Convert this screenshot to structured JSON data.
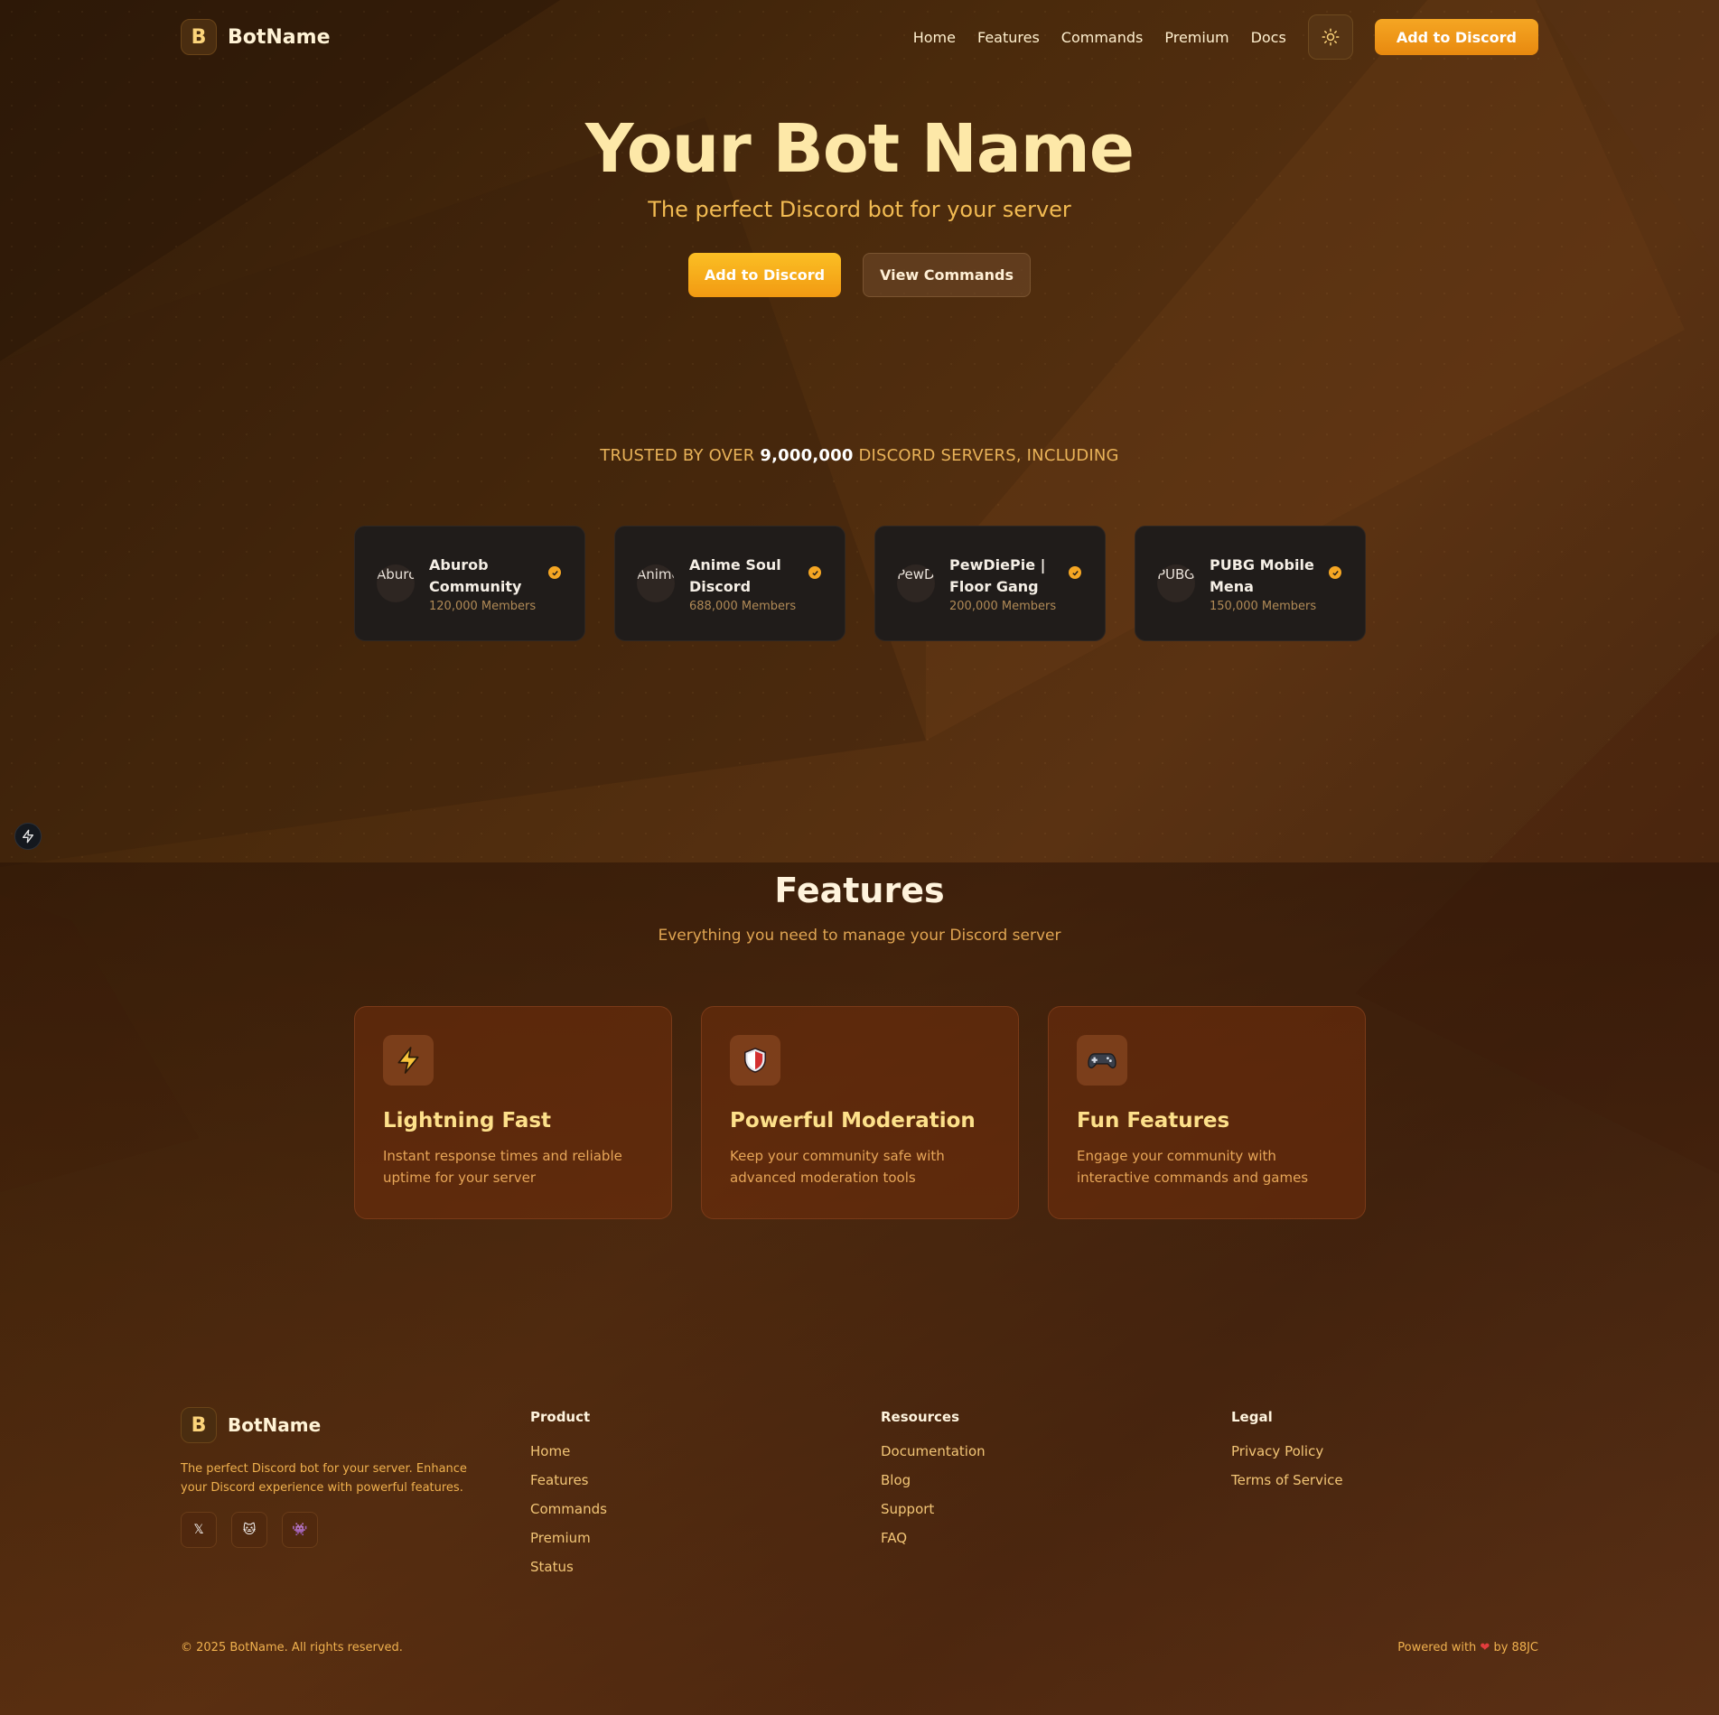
{
  "nav": {
    "logo_letter": "B",
    "brand": "BotName",
    "links": [
      "Home",
      "Features",
      "Commands",
      "Premium",
      "Docs"
    ],
    "theme_icon": "sun-icon",
    "cta": "Add to Discord"
  },
  "hero": {
    "title": "Your Bot Name",
    "subtitle": "The perfect Discord bot for your server",
    "primary_button": "Add to Discord",
    "secondary_button": "View Commands"
  },
  "trusted": {
    "prefix": "TRUSTED BY OVER",
    "count": "9,000,000",
    "suffix": "DISCORD SERVERS, INCLUDING"
  },
  "servers": [
    {
      "avatar_alt": "Aburob Community",
      "name": "Aburob Community",
      "members": "120,000 Members"
    },
    {
      "avatar_alt": "Anime Soul Discord",
      "name": "Anime Soul Discord",
      "members": "688,000 Members"
    },
    {
      "avatar_alt": "PewDiePie | Floor Gang",
      "name": "PewDiePie | Floor Gang",
      "members": "200,000 Members"
    },
    {
      "avatar_alt": "PUBG Mobile Mena",
      "name": "PUBG Mobile Mena",
      "members": "150,000 Members"
    }
  ],
  "features": {
    "title": "Features",
    "subtitle": "Everything you need to manage your Discord server",
    "cards": [
      {
        "icon": "lightning-icon",
        "title": "Lightning Fast",
        "desc": "Instant response times and reliable uptime for your server"
      },
      {
        "icon": "shield-icon",
        "title": "Powerful Moderation",
        "desc": "Keep your community safe with advanced moderation tools"
      },
      {
        "icon": "gamepad-icon",
        "title": "Fun Features",
        "desc": "Engage your community with interactive commands and games"
      }
    ]
  },
  "footer": {
    "logo_letter": "B",
    "brand": "BotName",
    "desc": "The perfect Discord bot for your server. Enhance your Discord experience with powerful features.",
    "socials": [
      {
        "icon": "x-icon",
        "glyph": "𝕏"
      },
      {
        "icon": "github-cat-icon",
        "glyph": "🐱"
      },
      {
        "icon": "discord-icon",
        "glyph": "👾"
      }
    ],
    "columns": [
      {
        "title": "Product",
        "links": [
          "Home",
          "Features",
          "Commands",
          "Premium",
          "Status"
        ]
      },
      {
        "title": "Resources",
        "links": [
          "Documentation",
          "Blog",
          "Support",
          "FAQ"
        ]
      },
      {
        "title": "Legal",
        "links": [
          "Privacy Policy",
          "Terms of Service"
        ]
      }
    ],
    "copyright": "© 2025 BotName. All rights reserved.",
    "powered_prefix": "Powered with",
    "powered_suffix": "by 88JC"
  },
  "colors": {
    "accent": "#f5a623",
    "background": "#3a1d0d",
    "card_dark": "#201c1a"
  }
}
